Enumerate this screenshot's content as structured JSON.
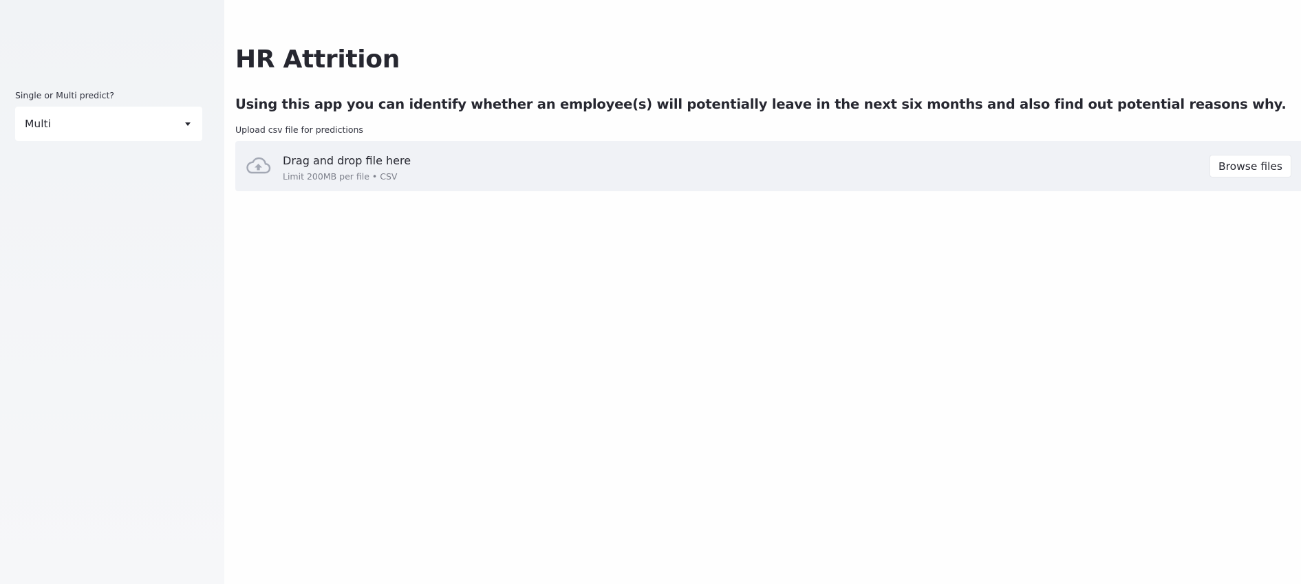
{
  "sidebar": {
    "select_label": "Single or Multi predict?",
    "select_value": "Multi",
    "select_icon": "caret-down-icon"
  },
  "main": {
    "title": "HR Attrition",
    "subtitle": "Using this app you can identify whether an employee(s) will potentially leave in the next six months and also find out potential reasons why.",
    "upload": {
      "label": "Upload csv file for predictions",
      "dropzone_text": "Drag and drop file here",
      "limit_text": "Limit 200MB per file • CSV",
      "browse_label": "Browse files",
      "icon": "cloud-upload-icon"
    }
  },
  "colors": {
    "sidebar_bg": "#f0f2f6",
    "main_bg": "#ffffff",
    "text": "#262730",
    "dropzone_bg": "#f0f2f6",
    "muted_text": "#7c7f8a"
  }
}
